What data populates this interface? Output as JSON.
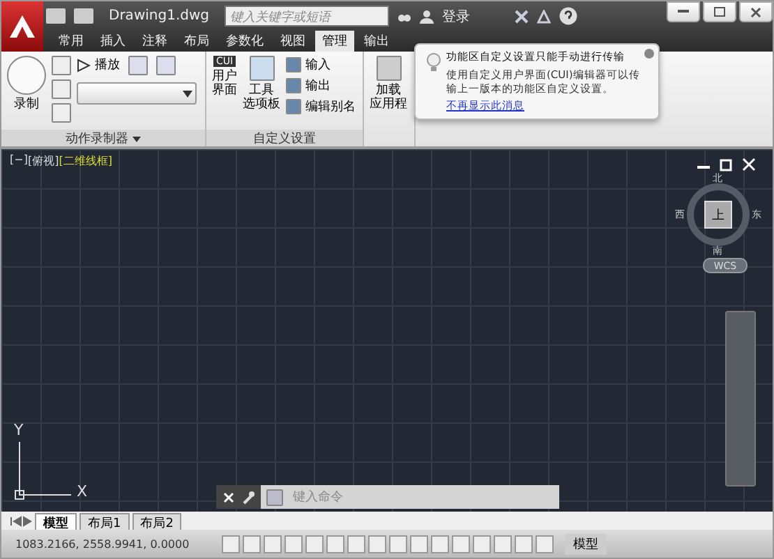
{
  "title_bar": {
    "file_name": "Drawing1.dwg",
    "search": {
      "placeholder": "键入关键字或短语"
    },
    "login": "登录"
  },
  "ribbon_tabs": [
    {
      "label": "常用",
      "selected": false
    },
    {
      "label": "插入",
      "selected": false
    },
    {
      "label": "注释",
      "selected": false
    },
    {
      "label": "布局",
      "selected": false
    },
    {
      "label": "参数化",
      "selected": false
    },
    {
      "label": "视图",
      "selected": false
    },
    {
      "label": "管理",
      "selected": true
    },
    {
      "label": "输出",
      "selected": false
    }
  ],
  "panels": [
    {
      "title": "动作录制器",
      "record": "录制",
      "play": "播放"
    },
    {
      "title": "自定义设置",
      "cui_badge": "CUI",
      "user_interface": [
        "用户",
        "界面"
      ],
      "tool_palettes": [
        "工具",
        "选项板"
      ],
      "actions": [
        "输入",
        "输出",
        "编辑别名"
      ]
    },
    {
      "load_app": [
        "加载",
        "应用程"
      ]
    }
  ],
  "popup": {
    "title": "功能区自定义设置只能手动进行传输",
    "body": "使用自定义用户界面(CUI)编辑器可以传输上一版本的功能区自定义设置。",
    "link": "不再显示此消息"
  },
  "viewport": {
    "label_parts": [
      "[−]",
      "[俯视]",
      "[二维线框]"
    ],
    "compass": {
      "north": "北",
      "south": "南",
      "east": "东",
      "west": "西",
      "top": "上"
    },
    "wcs": "WCS",
    "ucs": {
      "x": "X",
      "y": "Y"
    }
  },
  "command_line": {
    "placeholder": "键入命令"
  },
  "layout_tabs": [
    {
      "label": "模型",
      "selected": true
    },
    {
      "label": "布局1",
      "selected": false
    },
    {
      "label": "布局2",
      "selected": false
    }
  ],
  "status_bar": {
    "coordinates": "1083.2166, 2558.9941, 0.0000",
    "space": "模型"
  }
}
